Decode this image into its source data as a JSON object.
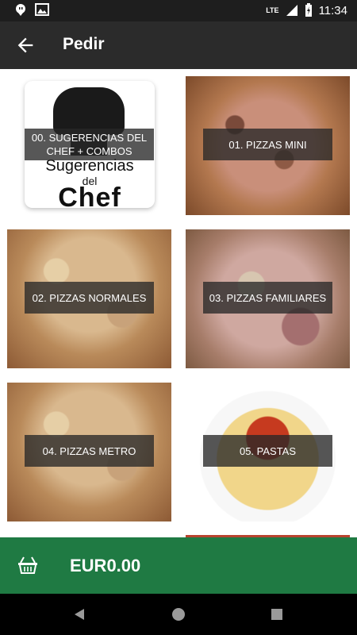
{
  "status_bar": {
    "time": "11:34",
    "network": "LTE"
  },
  "app_bar": {
    "title": "Pedir"
  },
  "categories": [
    {
      "label": "00. SUGERENCIAS DEL CHEF + COMBOS",
      "image": "chef-hat-logo",
      "logo_text": {
        "line1": "Sugerencias",
        "line2": "del",
        "line3": "Chef"
      }
    },
    {
      "label": "01. PIZZAS MINI",
      "image": "pizza"
    },
    {
      "label": "02. PIZZAS NORMALES",
      "image": "pizza"
    },
    {
      "label": "03. PIZZAS FAMILIARES",
      "image": "pizza"
    },
    {
      "label": "04. PIZZAS METRO",
      "image": "pizza"
    },
    {
      "label": "05. PASTAS",
      "image": "spaghetti"
    }
  ],
  "cart": {
    "total": "EUR0.00"
  },
  "colors": {
    "status_bar": "#1e1e1e",
    "app_bar": "#2b2b2b",
    "cart_bar": "#1f7a43",
    "nav_bar": "#000000"
  }
}
